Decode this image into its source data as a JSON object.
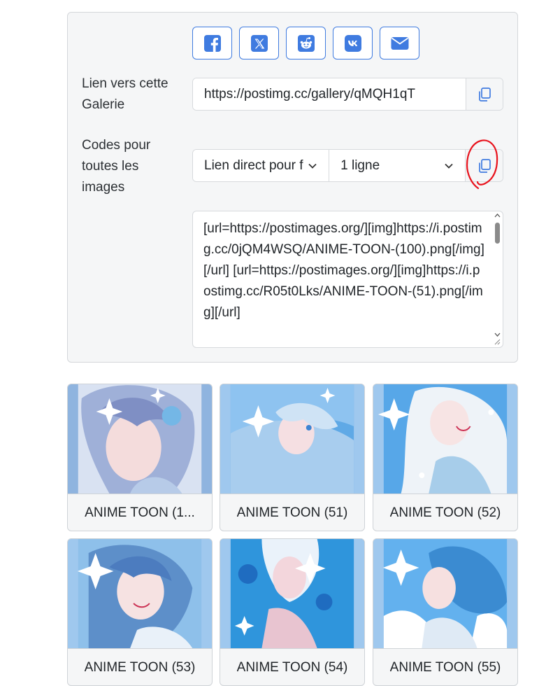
{
  "share": {
    "buttons": [
      {
        "name": "facebook-share-button",
        "icon": "facebook-icon"
      },
      {
        "name": "x-share-button",
        "icon": "x-icon"
      },
      {
        "name": "reddit-share-button",
        "icon": "reddit-icon"
      },
      {
        "name": "vk-share-button",
        "icon": "vk-icon"
      },
      {
        "name": "email-share-button",
        "icon": "envelope-icon"
      }
    ],
    "accent_color": "#3f7be0"
  },
  "gallery_link": {
    "label": "Lien vers cette Galerie",
    "value": "https://postimg.cc/gallery/qMQH1qT",
    "copy_icon": "copy-icon"
  },
  "codes": {
    "label": "Codes pour toutes les images",
    "format_select": "Lien direct pour forums",
    "lines_select": "1 ligne",
    "copy_icon": "copy-icon",
    "textarea_value": "[url=https://postimages.org/][img]https://i.postimg.cc/0jQM4WSQ/ANIME-TOON-(100).png[/img][/url]\n[url=https://postimages.org/][img]https://i.postimg.cc/R05t0Lks/ANIME-TOON-(51).png[/img][/url]"
  },
  "annotation": {
    "color": "#e8121c"
  },
  "gallery": {
    "items": [
      {
        "caption": "ANIME TOON (1..."
      },
      {
        "caption": "ANIME TOON (51)"
      },
      {
        "caption": "ANIME TOON (52)"
      },
      {
        "caption": "ANIME TOON (53)"
      },
      {
        "caption": "ANIME TOON (54)"
      },
      {
        "caption": "ANIME TOON (55)"
      }
    ]
  }
}
